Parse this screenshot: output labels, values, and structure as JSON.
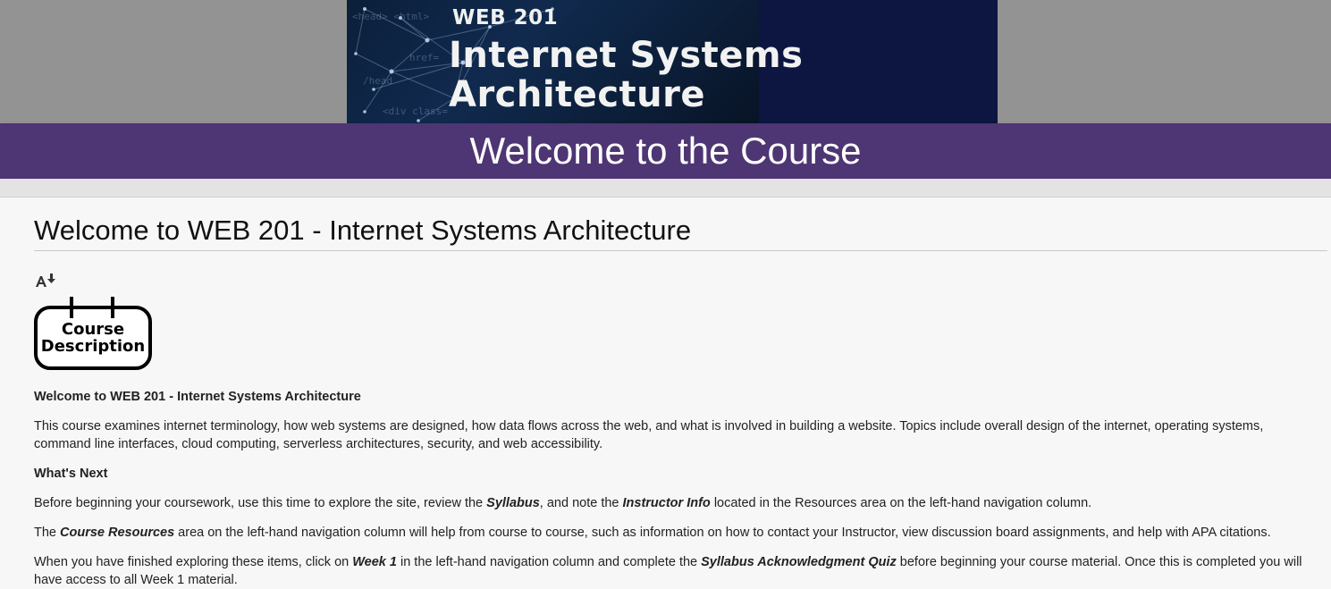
{
  "banner": {
    "subtitle": "WEB 201",
    "title_line1": "Internet Systems",
    "title_line2": "Architecture"
  },
  "header": {
    "welcome": "Welcome to the Course"
  },
  "main": {
    "page_title": "Welcome to WEB 201 - Internet Systems Architecture",
    "badge": {
      "line1": "Course",
      "line2": "Description"
    },
    "intro_heading": "Welcome to WEB 201 - Internet Systems Architecture",
    "intro_text": "This course examines internet terminology, how web systems are designed, how data flows across the web, and what is involved in building a website. Topics include overall design of the internet, operating systems, command line interfaces, cloud computing, serverless architectures, security, and web accessibility.",
    "next_heading": "What's Next",
    "p1": {
      "a": "Before beginning your coursework, use this time to explore the site, review the ",
      "b": "Syllabus",
      "c": ", and note the ",
      "d": "Instructor Info",
      "e": " located in the Resources area on the left-hand navigation column."
    },
    "p2": {
      "a": "The ",
      "b": "Course Resources",
      "c": " area on the left-hand navigation column will help from course to course, such as information on how to contact your Instructor, view discussion board assignments, and help with APA citations."
    },
    "p3": {
      "a": "When you have finished exploring these items, click on ",
      "b": "Week 1",
      "c": " in the left-hand navigation column and complete the ",
      "d": "Syllabus Acknowledgment Quiz",
      "e": " before beginning your course material. Once this is completed you will have access to all Week 1 material."
    }
  },
  "icons": {
    "accessibility": "alternative-formats-icon",
    "badge": "course-description-icon"
  },
  "colors": {
    "purple_bar": "#4e3573",
    "top_band": "#939393",
    "banner_dark": "#0a1030",
    "banner_right": "#0c1640"
  }
}
